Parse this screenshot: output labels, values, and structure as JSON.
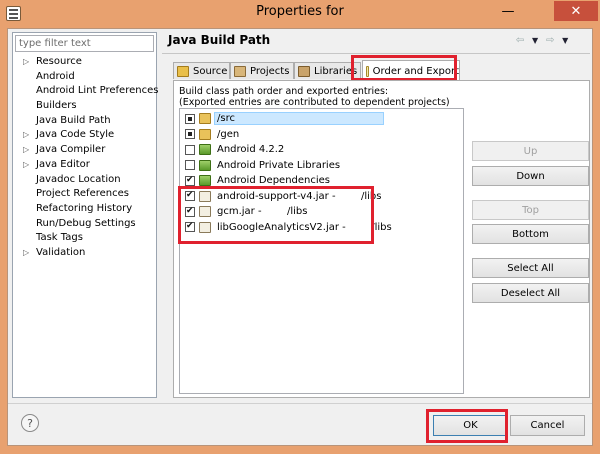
{
  "window": {
    "title": "Properties for",
    "minimize_label": "—",
    "close_label": "✕"
  },
  "filter": {
    "placeholder": "type filter text"
  },
  "sidebar": {
    "items": [
      {
        "label": "Resource",
        "expandable": true
      },
      {
        "label": "Android",
        "expandable": false
      },
      {
        "label": "Android Lint Preferences",
        "expandable": false
      },
      {
        "label": "Builders",
        "expandable": false
      },
      {
        "label": "Java Build Path",
        "expandable": false
      },
      {
        "label": "Java Code Style",
        "expandable": true
      },
      {
        "label": "Java Compiler",
        "expandable": true
      },
      {
        "label": "Java Editor",
        "expandable": true
      },
      {
        "label": "Javadoc Location",
        "expandable": false
      },
      {
        "label": "Project References",
        "expandable": false
      },
      {
        "label": "Refactoring History",
        "expandable": false
      },
      {
        "label": "Run/Debug Settings",
        "expandable": false
      },
      {
        "label": "Task Tags",
        "expandable": false
      },
      {
        "label": "Validation",
        "expandable": true
      }
    ]
  },
  "page": {
    "title": "Java Build Path",
    "nav_back": "⇦",
    "nav_forward": "⇨",
    "nav_menu": "▼"
  },
  "tabs": [
    {
      "label": "Source",
      "icon": "source-folder-icon"
    },
    {
      "label": "Projects",
      "icon": "projects-icon"
    },
    {
      "label": "Libraries",
      "icon": "libraries-icon"
    },
    {
      "label": "Order and Export",
      "icon": "order-export-icon",
      "active": true
    }
  ],
  "order_export": {
    "description_line1": "Build class path order and exported entries:",
    "description_line2": "(Exported entries are contributed to dependent projects)",
    "entries": [
      {
        "label": "/src",
        "check": "partial",
        "icon": "folder",
        "selected": true
      },
      {
        "label": "/gen",
        "check": "partial",
        "icon": "folder",
        "selected": false
      },
      {
        "label": "Android 4.2.2",
        "check": "unchecked",
        "icon": "android",
        "selected": false
      },
      {
        "label": "Android Private Libraries",
        "check": "unchecked",
        "icon": "android",
        "selected": false
      },
      {
        "label": "Android Dependencies",
        "check": "checked",
        "icon": "android",
        "selected": false
      },
      {
        "label": "android-support-v4.jar -        /libs",
        "check": "checked",
        "icon": "jar",
        "selected": false
      },
      {
        "label": "gcm.jar -        /libs",
        "check": "checked",
        "icon": "jar",
        "selected": false
      },
      {
        "label": "libGoogleAnalyticsV2.jar -        /libs",
        "check": "checked",
        "icon": "jar",
        "selected": false
      }
    ],
    "buttons": {
      "up": "Up",
      "down": "Down",
      "top": "Top",
      "bottom": "Bottom",
      "select_all": "Select All",
      "deselect_all": "Deselect All"
    }
  },
  "footer": {
    "help": "?",
    "ok": "OK",
    "cancel": "Cancel"
  },
  "colors": {
    "frame": "#e8a16f",
    "highlight": "#e0212e",
    "selection": "#cce8ff"
  }
}
